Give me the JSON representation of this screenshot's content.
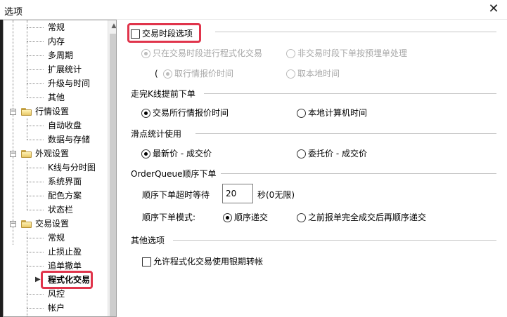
{
  "window": {
    "title": "选项",
    "close_glyph": "✕"
  },
  "tree": {
    "items": [
      {
        "label": "常规"
      },
      {
        "label": "内存"
      },
      {
        "label": "多周期"
      },
      {
        "label": "扩展统计"
      },
      {
        "label": "升级与时间"
      },
      {
        "label": "其他"
      },
      {
        "label": "行情设置"
      },
      {
        "label": "自动收盘"
      },
      {
        "label": "数据与存储"
      },
      {
        "label": "外观设置"
      },
      {
        "label": "K线与分时图"
      },
      {
        "label": "系统界面"
      },
      {
        "label": "配色方案"
      },
      {
        "label": "状态栏"
      },
      {
        "label": "交易设置"
      },
      {
        "label": "常规"
      },
      {
        "label": "止损止盈"
      },
      {
        "label": "追单撤单"
      },
      {
        "label": "程式化交易"
      },
      {
        "label": "风控"
      },
      {
        "label": "帐户"
      }
    ],
    "toggle_glyph": "−",
    "selected_label": "程式化交易"
  },
  "panel": {
    "trading_session": {
      "label": "交易时段选项",
      "checked": false,
      "opt_in_session": "只在交易时段进行程式化交易",
      "opt_out_session": "非交易时段下单按预埋单处理",
      "paren": "(",
      "opt_quote_time": "取行情报价时间",
      "opt_local_time": "取本地时间"
    },
    "k_early": {
      "heading": "走完K线提前下单",
      "opt_exchange_time": "交易所行情报价时间",
      "opt_local_computer_time": "本地计算机时间"
    },
    "slippage": {
      "heading": "滑点统计使用",
      "opt_latest": "最新价 - 成交价",
      "opt_order": "委托价 - 成交价"
    },
    "order_queue": {
      "heading": "OrderQueue顺序下单",
      "timeout_label": "顺序下单超时等待",
      "timeout_value": "20",
      "timeout_unit": "秒(0无限)",
      "mode_label": "顺序下单模式:",
      "opt_sequential": "顺序递交",
      "opt_after_complete": "之前报单完全成交后再顺序递交"
    },
    "other": {
      "heading": "其他选项",
      "bank_transfer_label": "允许程式化交易使用银期转帐",
      "bank_transfer_checked": false
    }
  },
  "colors": {
    "highlight": "#e0344b",
    "disabled_text": "#a8a8a8"
  }
}
